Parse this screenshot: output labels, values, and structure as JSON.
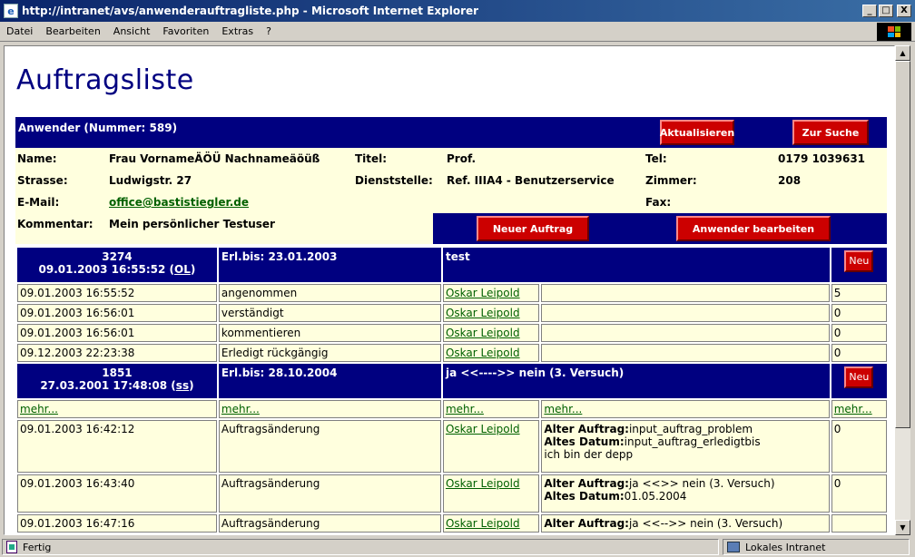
{
  "window": {
    "title": "http://intranet/avs/anwenderauftragliste.php - Microsoft Internet Explorer",
    "minimize": "_",
    "maximize": "□",
    "close": "X"
  },
  "menu": [
    "Datei",
    "Bearbeiten",
    "Ansicht",
    "Favoriten",
    "Extras",
    "?"
  ],
  "page": {
    "title": "Auftragsliste",
    "user_header": "Anwender (Nummer: 589)",
    "refresh_button": "Aktualisieren",
    "search_button": "Zur Suche",
    "new_order_button": "Neuer Auftrag",
    "edit_user_button": "Anwender bearbeiten",
    "user": {
      "name_label": "Name:",
      "name": "Frau VornameÄÖÜ Nachnameäöüß",
      "title_label": "Titel:",
      "title": "Prof.",
      "tel_label": "Tel:",
      "tel": "0179 1039631",
      "street_label": "Strasse:",
      "street": "Ludwigstr. 27",
      "office_label": "Dienststelle:",
      "office": "Ref. IIIA4 - Benutzerservice",
      "room_label": "Zimmer:",
      "room": "208",
      "email_label": "E-Mail:",
      "email": "office@bastistiegler.de",
      "fax_label": "Fax:",
      "fax": "",
      "comment_label": "Kommentar:",
      "comment": "Mein persönlicher Testuser"
    }
  },
  "orders": [
    {
      "id": "3274",
      "date": "09.01.2003 16:55:52",
      "code": "OL",
      "due": "Erl.bis: 23.01.2003",
      "subject": "test",
      "new_label": "Neu",
      "rows": [
        {
          "date": "09.01.2003 16:55:52",
          "action": "angenommen",
          "person": "Oskar Leipold",
          "details": "",
          "count": "5"
        },
        {
          "date": "09.01.2003 16:56:01",
          "action": "verständigt",
          "person": "Oskar Leipold",
          "details": "",
          "count": "0"
        },
        {
          "date": "09.01.2003 16:56:01",
          "action": "kommentieren",
          "person": "Oskar Leipold",
          "details": "",
          "count": "0"
        },
        {
          "date": "09.12.2003 22:23:38",
          "action": "Erledigt rückgängig",
          "person": "Oskar Leipold",
          "details": "",
          "count": "0"
        }
      ]
    },
    {
      "id": "1851",
      "date": "27.03.2001 17:48:08",
      "code": "ss",
      "due": "Erl.bis: 28.10.2004",
      "subject": "ja <<---->> nein (3. Versuch)",
      "new_label": "Neu",
      "more_label": "mehr...",
      "rows": [
        {
          "date": "09.01.2003 16:42:12",
          "action": "Auftragsänderung",
          "person": "Oskar Leipold",
          "old_order_label": "Alter Auftrag:",
          "old_order": "input_auftrag_problem",
          "old_date_label": "Altes Datum:",
          "old_date": "input_auftrag_erledigtbis",
          "extra": "ich bin der depp",
          "count": "0"
        },
        {
          "date": "09.01.2003 16:43:40",
          "action": "Auftragsänderung",
          "person": "Oskar Leipold",
          "old_order_label": "Alter Auftrag:",
          "old_order": "ja <<>> nein (3. Versuch)",
          "old_date_label": "Altes Datum:",
          "old_date": "01.05.2004",
          "extra": "",
          "count": "0"
        },
        {
          "date": "09.01.2003 16:47:16",
          "action": "Auftragsänderung",
          "person": "Oskar Leipold",
          "old_order_label": "Alter Auftrag:",
          "old_order": "ja <<-->> nein (3. Versuch)",
          "old_date_label": "",
          "old_date": "",
          "extra": "",
          "count": ""
        }
      ]
    }
  ],
  "status": {
    "text": "Fertig",
    "zone": "Lokales Intranet"
  },
  "colors": {
    "header_blue": "#000080",
    "cream": "#ffffde",
    "button_red": "#cc0000",
    "link_green": "#006000"
  }
}
